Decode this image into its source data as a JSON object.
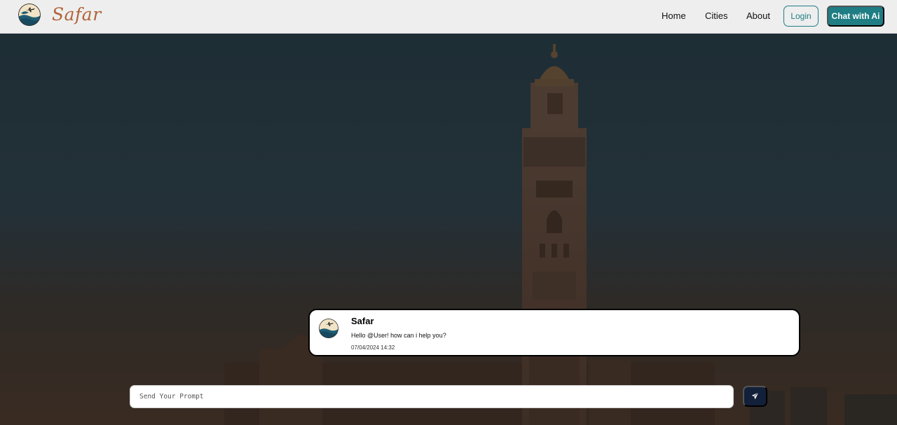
{
  "brand": {
    "name": "Safar",
    "logo_icon": "safar-logo-icon"
  },
  "nav": {
    "home": "Home",
    "cities": "Cities",
    "about": "About",
    "login": "Login",
    "chat": "Chat with Ai"
  },
  "colors": {
    "accent": "#1f7d84",
    "brand": "#b0643a",
    "send_button": "#13203a"
  },
  "chat": {
    "messages": [
      {
        "sender": "Safar",
        "text": "Hello @User! how can i help you?",
        "time": "07/04/2024 14:32",
        "avatar_icon": "safar-logo-icon"
      }
    ]
  },
  "input": {
    "placeholder": "Send Your Prompt",
    "value": "",
    "send_icon": "send-icon"
  }
}
